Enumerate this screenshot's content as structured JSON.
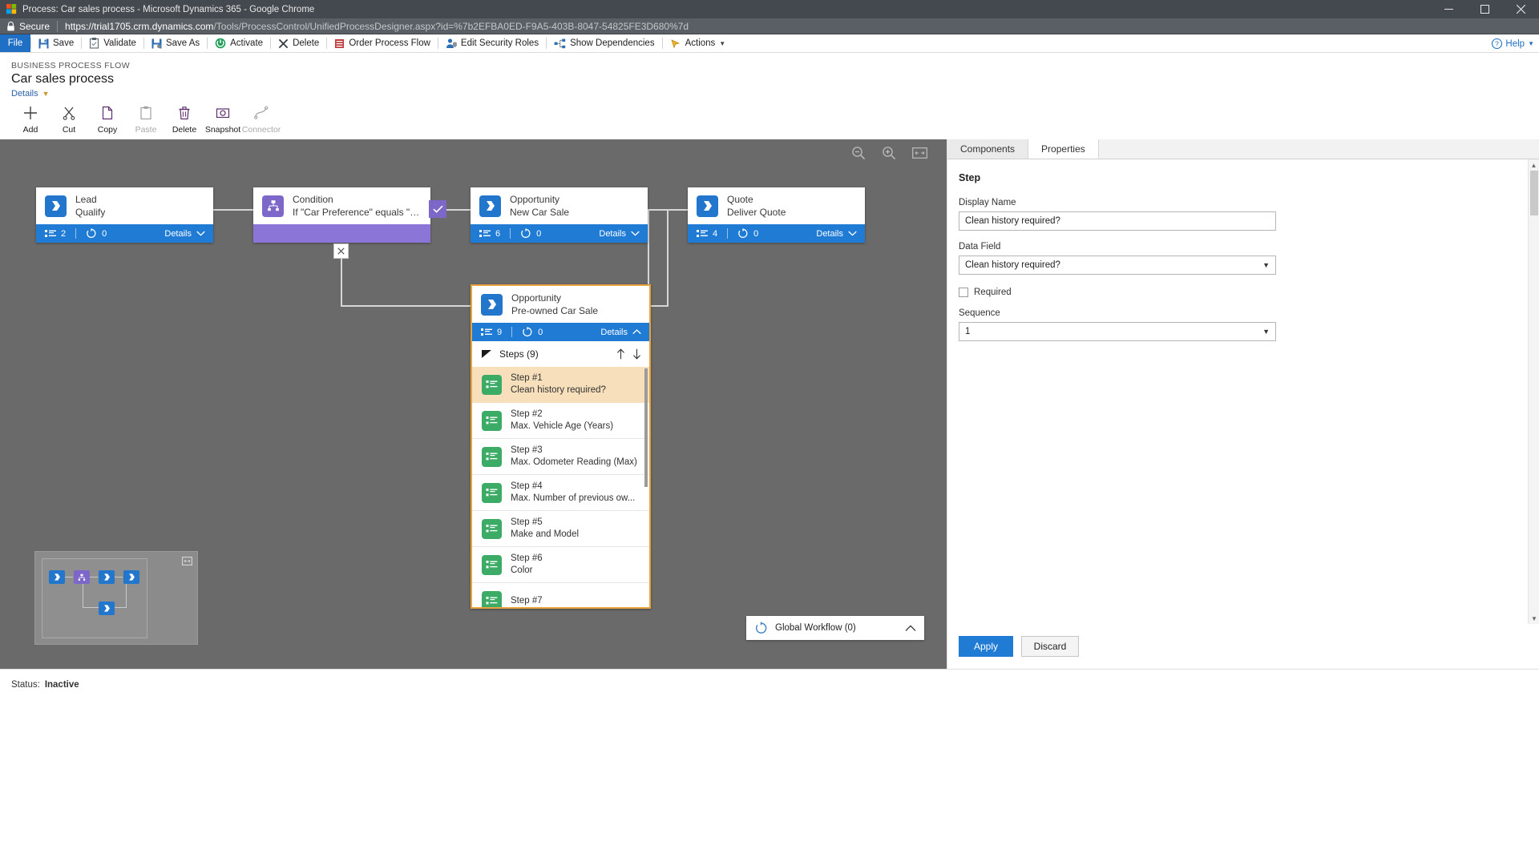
{
  "browser": {
    "window_title": "Process: Car sales process - Microsoft Dynamics 365 - Google Chrome",
    "security_label": "Secure",
    "url_strong": "https://trial1705.crm.dynamics.com",
    "url_dim": "/Tools/ProcessControl/UnifiedProcessDesigner.aspx?id=%7b2EFBA0ED-F9A5-403B-8047-54825FE3D680%7d",
    "minimize_icon": "minimize-icon",
    "maximize_icon": "maximize-icon",
    "close_icon": "close-icon",
    "favicon": "dynamics-favicon",
    "lock_icon": "lock-icon"
  },
  "commandbar": {
    "file": "File",
    "items": [
      {
        "label": "Save",
        "icon": "save-icon"
      },
      {
        "label": "Validate",
        "icon": "validate-icon"
      },
      {
        "label": "Save As",
        "icon": "save-as-icon"
      },
      {
        "label": "Activate",
        "icon": "activate-icon"
      },
      {
        "label": "Delete",
        "icon": "delete-icon"
      },
      {
        "label": "Order Process Flow",
        "icon": "order-process-flow-icon"
      },
      {
        "label": "Edit Security Roles",
        "icon": "edit-security-roles-icon"
      },
      {
        "label": "Show Dependencies",
        "icon": "show-dependencies-icon"
      },
      {
        "label": "Actions",
        "icon": "actions-icon"
      }
    ],
    "help": "Help"
  },
  "header": {
    "eyebrow": "BUSINESS PROCESS FLOW",
    "title": "Car sales process",
    "details_link": "Details"
  },
  "designtools": [
    {
      "label": "Add",
      "icon": "plus-icon",
      "disabled": false
    },
    {
      "label": "Cut",
      "icon": "scissors-icon",
      "disabled": false
    },
    {
      "label": "Copy",
      "icon": "copy-icon",
      "disabled": false
    },
    {
      "label": "Paste",
      "icon": "paste-icon",
      "disabled": true
    },
    {
      "label": "Delete",
      "icon": "trash-icon",
      "disabled": false
    },
    {
      "label": "Snapshot",
      "icon": "camera-icon",
      "disabled": false
    },
    {
      "label": "Connector",
      "icon": "connector-icon",
      "disabled": true
    }
  ],
  "canvas": {
    "zoom_out_icon": "zoom-out-icon",
    "zoom_in_icon": "zoom-in-icon",
    "fit_screen_icon": "fit-to-screen-icon",
    "nodes": [
      {
        "id": "lead",
        "entity": "Lead",
        "stage": "Qualify",
        "steps_count": "2",
        "loop_count": "0",
        "details_label": "Details",
        "icon": "stage-arrow-icon",
        "color": "#2277cd"
      },
      {
        "id": "condition",
        "entity": "Condition",
        "stage": "If \"Car Preference\" equals \"New ...",
        "details_label": "",
        "icon": "condition-branch-icon",
        "color": "#7d68ca"
      },
      {
        "id": "new-car-sale",
        "entity": "Opportunity",
        "stage": "New Car Sale",
        "steps_count": "6",
        "loop_count": "0",
        "details_label": "Details",
        "icon": "stage-arrow-icon",
        "color": "#2277cd"
      },
      {
        "id": "quote",
        "entity": "Quote",
        "stage": "Deliver Quote",
        "steps_count": "4",
        "loop_count": "0",
        "details_label": "Details",
        "icon": "stage-arrow-icon",
        "color": "#2277cd"
      },
      {
        "id": "preowned-car-sale",
        "entity": "Opportunity",
        "stage": "Pre-owned Car Sale",
        "steps_count": "9",
        "loop_count": "0",
        "details_label": "Details",
        "icon": "stage-arrow-icon",
        "color": "#2277cd",
        "selected": true
      }
    ],
    "steps_panel": {
      "header": "Steps (9)",
      "move_up_icon": "arrow-up-icon",
      "move_down_icon": "arrow-down-icon",
      "collapse_icon": "triangle-collapse-icon",
      "steps": [
        {
          "name": "Step #1",
          "desc": "Clean history required?",
          "active": true
        },
        {
          "name": "Step #2",
          "desc": "Max. Vehicle Age (Years)",
          "active": false
        },
        {
          "name": "Step #3",
          "desc": "Max. Odometer Reading (Max)",
          "active": false
        },
        {
          "name": "Step #4",
          "desc": "Max. Number of previous ow...",
          "active": false
        },
        {
          "name": "Step #5",
          "desc": "Make and Model",
          "active": false
        },
        {
          "name": "Step #6",
          "desc": "Color",
          "active": false
        },
        {
          "name": "Step #7",
          "desc": "",
          "active": false
        }
      ]
    },
    "global_workflow": {
      "label": "Global Workflow (0)",
      "icon": "workflow-loop-icon",
      "chevron": "chevron-up-icon"
    },
    "minimap": {
      "expand_icon": "expand-minimap-icon"
    }
  },
  "properties": {
    "tabs": [
      {
        "label": "Components",
        "active": false
      },
      {
        "label": "Properties",
        "active": true
      }
    ],
    "section_title": "Step",
    "display_name_label": "Display Name",
    "display_name_value": "Clean history required?",
    "data_field_label": "Data Field",
    "data_field_value": "Clean history required?",
    "required_label": "Required",
    "required_checked": false,
    "sequence_label": "Sequence",
    "sequence_value": "1",
    "apply_label": "Apply",
    "discard_label": "Discard"
  },
  "statusbar": {
    "label": "Status:",
    "value": "Inactive"
  }
}
